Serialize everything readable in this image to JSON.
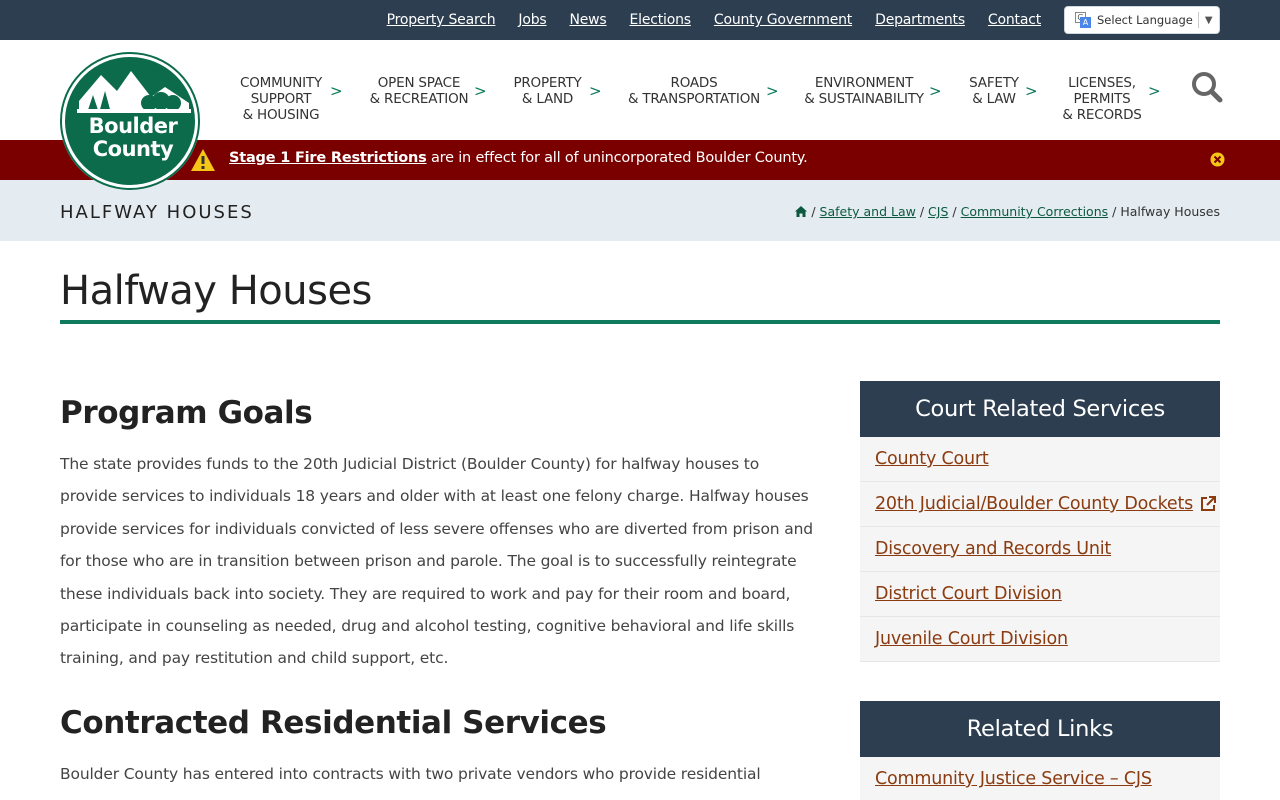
{
  "top_links": [
    "Property Search",
    "Jobs",
    "News",
    "Elections",
    "County Government",
    "Departments",
    "Contact"
  ],
  "language": {
    "label": "Select Language",
    "arrow": "▼"
  },
  "logo": {
    "line1": "Boulder",
    "line2": "County"
  },
  "nav": [
    {
      "label": "COMMUNITY\nSUPPORT\n& HOUSING"
    },
    {
      "label": "OPEN SPACE\n& RECREATION"
    },
    {
      "label": "PROPERTY\n& LAND"
    },
    {
      "label": "ROADS\n& TRANSPORTATION"
    },
    {
      "label": "ENVIRONMENT\n& SUSTAINABILITY"
    },
    {
      "label": "SAFETY\n& LAW"
    },
    {
      "label": "LICENSES,\nPERMITS\n& RECORDS"
    }
  ],
  "nav_chevron": ">",
  "alert": {
    "link": "Stage 1 Fire Restrictions",
    "text": " are in effect for all of unincorporated Boulder County.",
    "color": "#7a0000"
  },
  "page_header": {
    "title": "HALFWAY HOUSES"
  },
  "breadcrumb": {
    "items": [
      "Safety and Law",
      "CJS",
      "Community Corrections"
    ],
    "current": "Halfway Houses",
    "sep": "/"
  },
  "main": {
    "title": "Halfway Houses",
    "sections": [
      {
        "heading": "Program Goals",
        "body": "The state provides funds to the 20th Judicial District (Boulder County) for halfway houses to provide services to individuals 18 years and older with at least one felony charge. Halfway houses provide services for individuals convicted of less severe offenses who are diverted from prison and for those who are in transition between prison and parole. The goal is to successfully reintegrate these individuals back into society. They are required to work and pay for their room and board, participate in counseling as needed, drug and alcohol testing, cognitive behavioral and life skills training, and pay restitution and child support, etc."
      },
      {
        "heading": "Contracted Residential Services",
        "body": "Boulder County has entered into contracts with two private vendors who provide residential"
      }
    ]
  },
  "sidebar": [
    {
      "heading": "Court Related Services",
      "links": [
        "County Court",
        "20th Judicial/Boulder County Dockets",
        "Discovery and Records Unit",
        "District Court Division",
        "Juvenile Court Division"
      ]
    },
    {
      "heading": "Related Links",
      "links": [
        "Community Justice Service – CJS"
      ]
    }
  ],
  "colors": {
    "dark_navy": "#2c3e50",
    "brand_green": "#0b6b4b",
    "link_brown": "#8a3b10",
    "alert_red": "#7a0000"
  }
}
